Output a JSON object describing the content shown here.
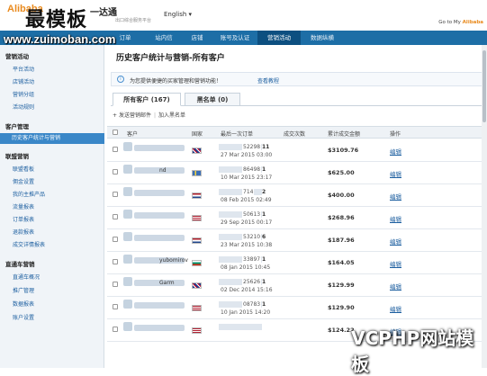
{
  "header": {
    "logo_text": "Alibaba",
    "logo_cn": "一达通",
    "logo_sub": "出口综合服务平台",
    "language": "English ▾",
    "goto_prefix": "Go to My",
    "goto_brand": "Alibaba"
  },
  "watermarks": {
    "top": "最模板",
    "url": "www.zuimoban.com",
    "bottom": "VCPHP网站模板"
  },
  "nav": {
    "items": [
      "订单",
      "站内信",
      "店铺",
      "账号及认证",
      "营销活动",
      "数据纵横"
    ],
    "active_index": 4
  },
  "sidebar": {
    "sections": [
      {
        "title": "营销活动",
        "items": [
          "平台活动",
          "店铺活动",
          "营销分组",
          "活动规则"
        ]
      },
      {
        "title": "客户管理",
        "items": [
          "历史客户统计与营销"
        ],
        "active": "历史客户统计与营销"
      },
      {
        "title": "联盟营销",
        "items": [
          "联盟看板",
          "佣金设置",
          "我的主推产品",
          "流量报表",
          "订单报表",
          "退款报表",
          "成交详情报表"
        ]
      },
      {
        "title": "直通车营销",
        "items": [
          "直通车概况",
          "推广管理",
          "数据报表",
          "账户设置"
        ]
      }
    ]
  },
  "main": {
    "title": "历史客户统计与营销-所有客户",
    "notice_text": "为您提供便捷的买家管理和营销功能！",
    "notice_link": "查看教程",
    "tabs": [
      {
        "label": "所有客户 (167)",
        "active": true
      },
      {
        "label": "黑名单 (0)",
        "active": false
      }
    ],
    "toolbar": {
      "send_mail": "发送营销邮件",
      "add_blacklist": "加入黑名单"
    },
    "table": {
      "headers": {
        "customer": "客户",
        "country": "国家",
        "last_order": "最后一次订单",
        "count": "成交次数",
        "amount": "累计成交金额",
        "action": "操作"
      },
      "rows": [
        {
          "name": "",
          "flag": "uk",
          "order_id": "52298",
          "count": "11",
          "date": "27 Mar 2015 03:00",
          "amount": "$3109.76",
          "action": "编辑"
        },
        {
          "name": "nd",
          "flag": "se",
          "order_id": "86498",
          "count": "1",
          "date": "10 Mar 2015 23:17",
          "amount": "$625.00",
          "action": "编辑"
        },
        {
          "name": "",
          "flag": "nl",
          "order_id": "714",
          "count": "2",
          "date": "08 Feb 2015 02:49",
          "amount": "$400.00",
          "action": "编辑"
        },
        {
          "name": "",
          "flag": "us",
          "order_id": "50613",
          "count": "1",
          "date": "29 Sep 2015 00:17",
          "amount": "$268.96",
          "action": "编辑"
        },
        {
          "name": "",
          "flag": "nl",
          "order_id": "53210",
          "count": "6",
          "date": "23 Mar 2015 10:38",
          "amount": "$187.96",
          "action": "编辑"
        },
        {
          "name": "yubomirov",
          "flag": "bg",
          "order_id": "33897",
          "count": "1",
          "date": "08 Jan 2015 10:45",
          "amount": "$164.05",
          "action": "编辑"
        },
        {
          "name": "Garm",
          "flag": "uk",
          "order_id": "25626",
          "count": "1",
          "date": "02 Dec 2014 15:16",
          "amount": "$129.99",
          "action": "编辑"
        },
        {
          "name": "",
          "flag": "us",
          "order_id": "08783",
          "count": "1",
          "date": "10 Jan 2015 14:20",
          "amount": "$129.90",
          "action": "编辑"
        },
        {
          "name": "",
          "flag": "us",
          "order_id": "",
          "count": "",
          "date": "",
          "amount": "$124.22",
          "action": "编辑"
        }
      ]
    }
  },
  "colors": {
    "nav_bg": "#1d6ea6",
    "nav_active": "#0d4f80",
    "sidebar_active": "#3a87c8",
    "link": "#1d5fa0",
    "brand": "#e98b1f"
  }
}
